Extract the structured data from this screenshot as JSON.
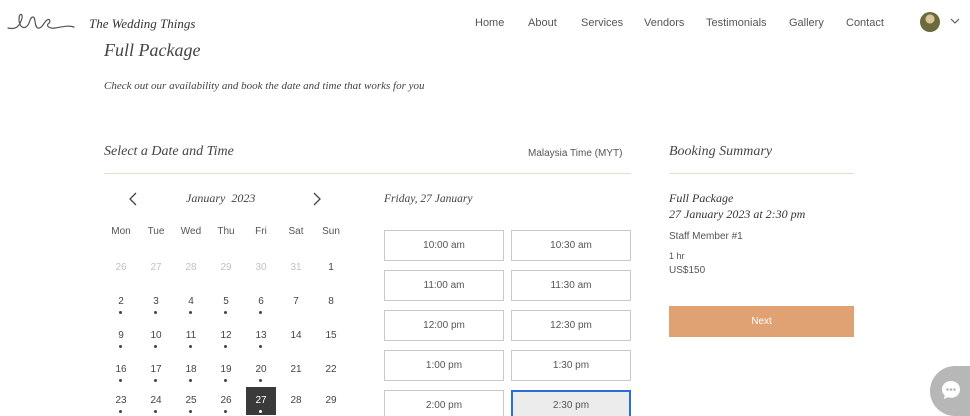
{
  "header": {
    "site_title": "The Wedding Things",
    "nav": [
      "Home",
      "About",
      "Services",
      "Vendors",
      "Testimonials",
      "Gallery",
      "Contact"
    ]
  },
  "intro": {
    "title": "Full Package",
    "subtitle": "Check out our availability and book the date and time that works for you"
  },
  "section": {
    "title": "Select a Date and Time",
    "timezone": "Malaysia Time (MYT)"
  },
  "calendar": {
    "month": "January",
    "year": "2023",
    "weekdays": [
      "Mon",
      "Tue",
      "Wed",
      "Thu",
      "Fri",
      "Sat",
      "Sun"
    ],
    "weeks": [
      [
        "26",
        "27",
        "28",
        "29",
        "30",
        "31",
        "1"
      ],
      [
        "2",
        "3",
        "4",
        "5",
        "6",
        "7",
        "8"
      ],
      [
        "9",
        "10",
        "11",
        "12",
        "13",
        "14",
        "15"
      ],
      [
        "16",
        "17",
        "18",
        "19",
        "20",
        "21",
        "22"
      ],
      [
        "23",
        "24",
        "25",
        "26",
        "27",
        "28",
        "29"
      ]
    ],
    "selected_day": "27"
  },
  "slots": {
    "date_label": "Friday, 27 January",
    "times": [
      "10:00 am",
      "10:30 am",
      "11:00 am",
      "11:30 am",
      "12:00 pm",
      "12:30 pm",
      "1:00 pm",
      "1:30 pm",
      "2:00 pm",
      "2:30 pm"
    ],
    "selected": "2:30 pm"
  },
  "summary": {
    "title": "Booking Summary",
    "package": "Full Package",
    "datetime": "27 January 2023 at 2:30 pm",
    "staff": "Staff Member #1",
    "duration": "1 hr",
    "price": "US$150",
    "next_label": "Next"
  },
  "colors": {
    "accent": "#e0a173",
    "rule": "#eadcc8",
    "selected_day_bg": "#3a3a3a",
    "slot_focus": "#2a6fd6"
  }
}
